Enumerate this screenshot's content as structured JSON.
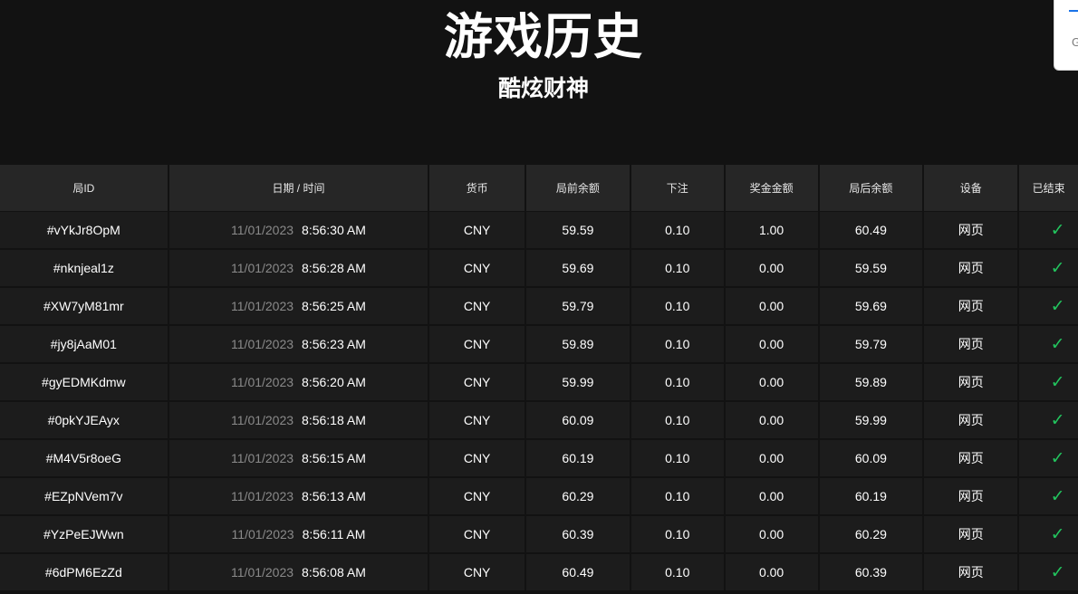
{
  "page": {
    "title": "游戏历史",
    "subtitle": "酷炫财神"
  },
  "corner_widget": {
    "glyph": "G"
  },
  "table": {
    "headers": {
      "id": "局ID",
      "datetime": "日期 / 时间",
      "currency": "货币",
      "balance_before": "局前余额",
      "bet": "下注",
      "win": "奖金金额",
      "balance_after": "局后余额",
      "device": "设备",
      "status": "已结束"
    },
    "rows": [
      {
        "id": "#vYkJr8OpM",
        "date": "11/01/2023",
        "time": "8:56:30 AM",
        "currency": "CNY",
        "before": "59.59",
        "bet": "0.10",
        "win": "1.00",
        "after": "60.49",
        "device": "网页",
        "done": "✓"
      },
      {
        "id": "#nknjeal1z",
        "date": "11/01/2023",
        "time": "8:56:28 AM",
        "currency": "CNY",
        "before": "59.69",
        "bet": "0.10",
        "win": "0.00",
        "after": "59.59",
        "device": "网页",
        "done": "✓"
      },
      {
        "id": "#XW7yM81mr",
        "date": "11/01/2023",
        "time": "8:56:25 AM",
        "currency": "CNY",
        "before": "59.79",
        "bet": "0.10",
        "win": "0.00",
        "after": "59.69",
        "device": "网页",
        "done": "✓"
      },
      {
        "id": "#jy8jAaM01",
        "date": "11/01/2023",
        "time": "8:56:23 AM",
        "currency": "CNY",
        "before": "59.89",
        "bet": "0.10",
        "win": "0.00",
        "after": "59.79",
        "device": "网页",
        "done": "✓"
      },
      {
        "id": "#gyEDMKdmw",
        "date": "11/01/2023",
        "time": "8:56:20 AM",
        "currency": "CNY",
        "before": "59.99",
        "bet": "0.10",
        "win": "0.00",
        "after": "59.89",
        "device": "网页",
        "done": "✓"
      },
      {
        "id": "#0pkYJEAyx",
        "date": "11/01/2023",
        "time": "8:56:18 AM",
        "currency": "CNY",
        "before": "60.09",
        "bet": "0.10",
        "win": "0.00",
        "after": "59.99",
        "device": "网页",
        "done": "✓"
      },
      {
        "id": "#M4V5r8oeG",
        "date": "11/01/2023",
        "time": "8:56:15 AM",
        "currency": "CNY",
        "before": "60.19",
        "bet": "0.10",
        "win": "0.00",
        "after": "60.09",
        "device": "网页",
        "done": "✓"
      },
      {
        "id": "#EZpNVem7v",
        "date": "11/01/2023",
        "time": "8:56:13 AM",
        "currency": "CNY",
        "before": "60.29",
        "bet": "0.10",
        "win": "0.00",
        "after": "60.19",
        "device": "网页",
        "done": "✓"
      },
      {
        "id": "#YzPeEJWwn",
        "date": "11/01/2023",
        "time": "8:56:11 AM",
        "currency": "CNY",
        "before": "60.39",
        "bet": "0.10",
        "win": "0.00",
        "after": "60.29",
        "device": "网页",
        "done": "✓"
      },
      {
        "id": "#6dPM6EzZd",
        "date": "11/01/2023",
        "time": "8:56:08 AM",
        "currency": "CNY",
        "before": "60.49",
        "bet": "0.10",
        "win": "0.00",
        "after": "60.39",
        "device": "网页",
        "done": "✓"
      }
    ]
  },
  "colors": {
    "background": "#121212",
    "row_background": "#1c1c1c",
    "header_background": "#262626",
    "date_text": "#8a8a8a",
    "check_mark": "#22c55e"
  },
  "icons": {
    "status_done": "checkmark-icon"
  }
}
